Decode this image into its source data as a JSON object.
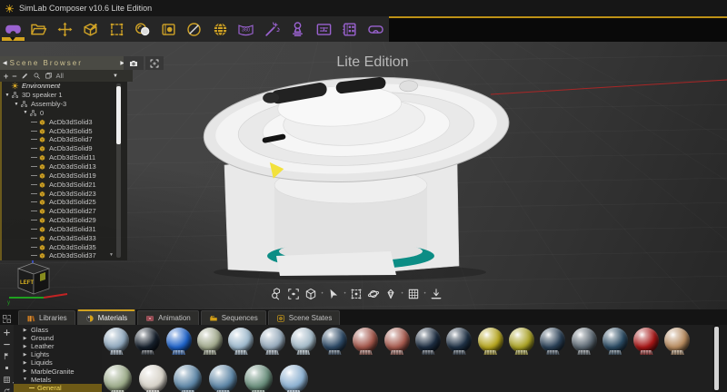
{
  "window": {
    "title": "SimLab Composer v10.6 Lite Edition"
  },
  "main_toolbar": {
    "accent_color": "#d1a21f",
    "purple_color": "#9a62d0",
    "panorama_label": "360",
    "items": [
      {
        "name": "vr-mode",
        "icon": "vr-headset-filled",
        "tint": "purple",
        "active": true
      },
      {
        "name": "open-scene",
        "icon": "folder-open",
        "tint": "gold"
      },
      {
        "name": "move",
        "icon": "move-arrows",
        "tint": "gold"
      },
      {
        "name": "edit-3d",
        "icon": "box-pen",
        "tint": "gold"
      },
      {
        "name": "select-area",
        "icon": "select-rect",
        "tint": "gold"
      },
      {
        "name": "render",
        "icon": "render-spheres",
        "tint": "gold"
      },
      {
        "name": "texture-image",
        "icon": "image-frame",
        "tint": "gold"
      },
      {
        "name": "no-render",
        "icon": "slash-circle",
        "tint": "gold"
      },
      {
        "name": "geo-location",
        "icon": "globe",
        "tint": "gold"
      },
      {
        "name": "panorama-360",
        "icon": "screen-360",
        "tint": "purple"
      },
      {
        "name": "wizard",
        "icon": "magic-wand",
        "tint": "purple"
      },
      {
        "name": "lighting",
        "icon": "desk-lamp",
        "tint": "purple"
      },
      {
        "name": "node-editor",
        "icon": "sliders-panel",
        "tint": "purple"
      },
      {
        "name": "storyboard",
        "icon": "storyboard-grid",
        "tint": "purple"
      },
      {
        "name": "vr-viewer",
        "icon": "vr-glasses-outline",
        "tint": "purple"
      }
    ]
  },
  "scene_browser": {
    "title": "Scene Browser",
    "filter_value": "All",
    "tree": [
      {
        "label": "Environment",
        "depth": 0,
        "icon": "sun",
        "italic": true
      },
      {
        "label": "3D speaker 1",
        "depth": 0,
        "icon": "node",
        "expanded": true
      },
      {
        "label": "Assembly-3",
        "depth": 1,
        "icon": "node",
        "expanded": true
      },
      {
        "label": "0",
        "depth": 2,
        "icon": "node",
        "expanded": true
      },
      {
        "label": "AcDb3dSolid3",
        "depth": 3,
        "icon": "solid"
      },
      {
        "label": "AcDb3dSolid5",
        "depth": 3,
        "icon": "solid"
      },
      {
        "label": "AcDb3dSolid7",
        "depth": 3,
        "icon": "solid"
      },
      {
        "label": "AcDb3dSolid9",
        "depth": 3,
        "icon": "solid"
      },
      {
        "label": "AcDb3dSolid11",
        "depth": 3,
        "icon": "solid"
      },
      {
        "label": "AcDb3dSolid13",
        "depth": 3,
        "icon": "solid"
      },
      {
        "label": "AcDb3dSolid19",
        "depth": 3,
        "icon": "solid"
      },
      {
        "label": "AcDb3dSolid21",
        "depth": 3,
        "icon": "solid"
      },
      {
        "label": "AcDb3dSolid23",
        "depth": 3,
        "icon": "solid"
      },
      {
        "label": "AcDb3dSolid25",
        "depth": 3,
        "icon": "solid"
      },
      {
        "label": "AcDb3dSolid27",
        "depth": 3,
        "icon": "solid"
      },
      {
        "label": "AcDb3dSolid29",
        "depth": 3,
        "icon": "solid"
      },
      {
        "label": "AcDb3dSolid31",
        "depth": 3,
        "icon": "solid"
      },
      {
        "label": "AcDb3dSolid33",
        "depth": 3,
        "icon": "solid"
      },
      {
        "label": "AcDb3dSolid35",
        "depth": 3,
        "icon": "solid"
      },
      {
        "label": "AcDb3dSolid37",
        "depth": 3,
        "icon": "solid"
      }
    ]
  },
  "viewport": {
    "watermark": "Lite Edition",
    "nav_cube_face": "LEFT",
    "axis_colors": {
      "x": "#c22323",
      "y": "#1fa11f",
      "z": "#3c55e6"
    },
    "model_accent_teal": "#0c8d85",
    "toolbar": [
      "zoom-extents",
      "fit-selection",
      "iso-view",
      "select-cursor",
      "select-handles",
      "orbit",
      "perspective-gem",
      "grid-toggle",
      "drop-to-ground"
    ]
  },
  "bottom_panel": {
    "tabs": [
      {
        "label": "Libraries",
        "icon": "books"
      },
      {
        "label": "Materials",
        "icon": "material-sphere",
        "active": true
      },
      {
        "label": "Animation",
        "icon": "film-strip"
      },
      {
        "label": "Sequences",
        "icon": "sequence-folder"
      },
      {
        "label": "Scene States",
        "icon": "scene-state"
      }
    ],
    "side_tools": [
      "add",
      "remove",
      "assign-flag",
      "swatch-size",
      "grid-view",
      "refresh"
    ],
    "categories": [
      {
        "label": "Glass",
        "depth": 0,
        "expanded": false
      },
      {
        "label": "Ground",
        "depth": 0,
        "expanded": false
      },
      {
        "label": "Leather",
        "depth": 0,
        "expanded": false
      },
      {
        "label": "Lights",
        "depth": 0,
        "expanded": false
      },
      {
        "label": "Liquids",
        "depth": 0,
        "expanded": false
      },
      {
        "label": "MarbleGranite",
        "depth": 0,
        "expanded": false
      },
      {
        "label": "Metals",
        "depth": 0,
        "expanded": true
      },
      {
        "label": "General",
        "depth": 1,
        "selected": true
      }
    ],
    "selected_category_color": "#6e5a16",
    "swatches": {
      "row1": [
        "#8fa7bc",
        "#16202c",
        "#1e62c8",
        "#a0a88c",
        "#9db8cc",
        "#96aabb",
        "#a4bac8",
        "#2e4a66",
        "#a2564a",
        "#a65a4e",
        "#1c2c40",
        "#1e3044",
        "#b4a41e",
        "#aaa226",
        "#2a4056",
        "#5c6872",
        "#2a4a62",
        "#a61616",
        "#b68a5e"
      ],
      "row2": [
        "#9cab8a",
        "#d6d2c8",
        "#5e86a6",
        "#5e86a6",
        "#6a8e7c",
        "#8cb0d0"
      ]
    }
  }
}
